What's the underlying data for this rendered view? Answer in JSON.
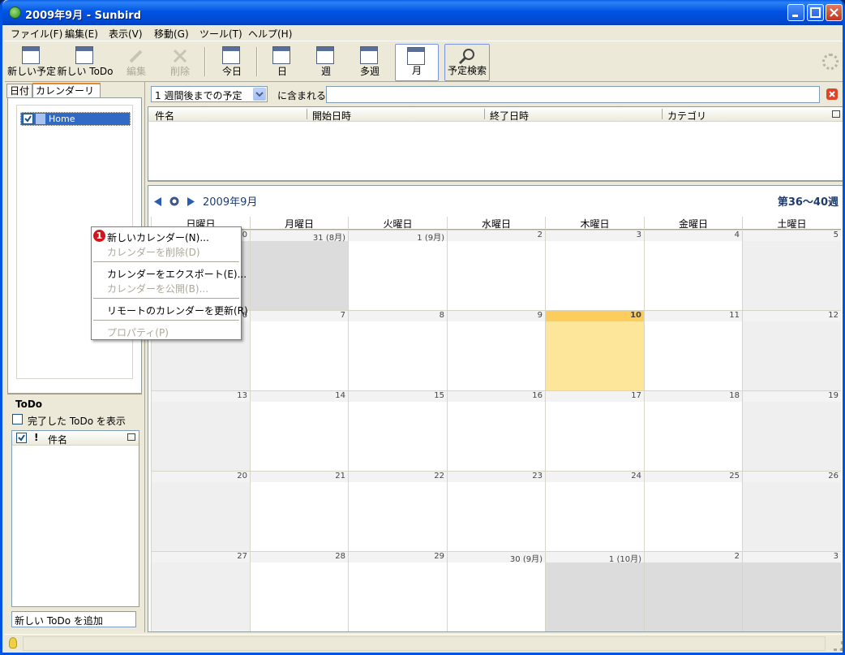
{
  "window": {
    "title": "2009年9月 - Sunbird"
  },
  "menubar": [
    "ファイル(F)",
    "編集(E)",
    "表示(V)",
    "移動(G)",
    "ツール(T)",
    "ヘルプ(H)"
  ],
  "toolbar": {
    "new_event": "新しい予定",
    "new_todo": "新しい ToDo",
    "edit": "編集",
    "delete": "削除",
    "today": "今日",
    "day": "日",
    "week": "週",
    "multiweek": "多週",
    "month": "月",
    "find": "予定検索"
  },
  "left": {
    "tab_date": "日付",
    "tab_calendars": "カレンダーリスト",
    "calendars": [
      "Home"
    ],
    "todo_title": "ToDo",
    "show_completed": "完了した ToDo を表示",
    "todo_col_title": "件名",
    "todo_add_placeholder": "新しい ToDo を追加"
  },
  "filter": {
    "selected": "1 週間後までの予定",
    "contains_label": "に含まれる",
    "value": ""
  },
  "events_columns": [
    "件名",
    "開始日時",
    "終了日時",
    "カテゴリ"
  ],
  "calendar": {
    "title": "2009年9月",
    "week_range": "第36〜40週",
    "weekdays": [
      "日曜日",
      "月曜日",
      "火曜日",
      "水曜日",
      "木曜日",
      "金曜日",
      "土曜日"
    ],
    "weeks": [
      [
        {
          "d": "30",
          "t": "other"
        },
        {
          "d": "31 (8月)",
          "t": "other"
        },
        {
          "d": "1 (9月)",
          "t": ""
        },
        {
          "d": "2",
          "t": ""
        },
        {
          "d": "3",
          "t": ""
        },
        {
          "d": "4",
          "t": ""
        },
        {
          "d": "5",
          "t": "we"
        }
      ],
      [
        {
          "d": "6",
          "t": "we"
        },
        {
          "d": "7",
          "t": ""
        },
        {
          "d": "8",
          "t": ""
        },
        {
          "d": "9",
          "t": ""
        },
        {
          "d": "10",
          "t": "today"
        },
        {
          "d": "11",
          "t": ""
        },
        {
          "d": "12",
          "t": "we"
        }
      ],
      [
        {
          "d": "13",
          "t": "we"
        },
        {
          "d": "14",
          "t": ""
        },
        {
          "d": "15",
          "t": ""
        },
        {
          "d": "16",
          "t": ""
        },
        {
          "d": "17",
          "t": ""
        },
        {
          "d": "18",
          "t": ""
        },
        {
          "d": "19",
          "t": "we"
        }
      ],
      [
        {
          "d": "20",
          "t": "we"
        },
        {
          "d": "21",
          "t": ""
        },
        {
          "d": "22",
          "t": ""
        },
        {
          "d": "23",
          "t": ""
        },
        {
          "d": "24",
          "t": ""
        },
        {
          "d": "25",
          "t": ""
        },
        {
          "d": "26",
          "t": "we"
        }
      ],
      [
        {
          "d": "27",
          "t": "we"
        },
        {
          "d": "28",
          "t": ""
        },
        {
          "d": "29",
          "t": ""
        },
        {
          "d": "30 (9月)",
          "t": ""
        },
        {
          "d": "1 (10月)",
          "t": "other"
        },
        {
          "d": "2",
          "t": "other"
        },
        {
          "d": "3",
          "t": "other"
        }
      ]
    ]
  },
  "context_menu": {
    "badge": "1",
    "items": [
      {
        "label": "新しいカレンダー(N)...",
        "enabled": true
      },
      {
        "label": "カレンダーを削除(D)",
        "enabled": false
      },
      {
        "label": "カレンダーをエクスポート(E)...",
        "enabled": true
      },
      {
        "label": "カレンダーを公開(B)...",
        "enabled": false
      },
      {
        "label": "リモートのカレンダーを更新(R)",
        "enabled": true
      },
      {
        "label": "プロパティ(P)",
        "enabled": false
      }
    ]
  },
  "colors": {
    "today": "#fde59a",
    "titlebar": "#0054e3",
    "selection": "#316ac5"
  }
}
